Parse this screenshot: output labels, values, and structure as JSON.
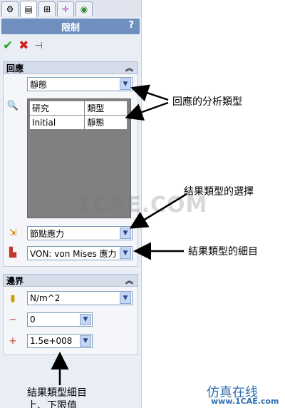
{
  "panel": {
    "title": "限制",
    "help": "?",
    "tabs": [
      "feature-manager-icon",
      "property-manager-icon",
      "configuration-manager-icon",
      "dimxpert-icon",
      "display-manager-icon"
    ],
    "actions": {
      "ok": "✔",
      "cancel": "✖",
      "pin": "⊣"
    }
  },
  "response": {
    "header": "回應",
    "analysis_type": "靜態",
    "table": {
      "headers": [
        "研究",
        "類型"
      ],
      "rows": [
        [
          "Initial",
          "靜態"
        ]
      ]
    },
    "result_type": "節點應力",
    "result_component": "VON:    von Mises 應力"
  },
  "bounds": {
    "header": "邊界",
    "units": "N/m^2",
    "lower": "0",
    "upper": "1.5e+008",
    "minus_symbol": "−",
    "plus_symbol": "+"
  },
  "annotations": {
    "analysis_type_note": "回應的分析類型",
    "result_type_selection": "結果類型的選擇",
    "result_component_note": "結果類型的細目",
    "bounds_note_line1": "結果類型細目",
    "bounds_note_line2": "上、下限值"
  },
  "watermark": "1CAE.COM",
  "brand": {
    "line1": "仿真在线",
    "line2": "www.1CAE.com"
  },
  "colors": {
    "title_bar": "#6f8fbf",
    "ok_green": "#2aa52a",
    "cancel_red": "#d22020",
    "brand_blue": "#2f6fb1"
  }
}
